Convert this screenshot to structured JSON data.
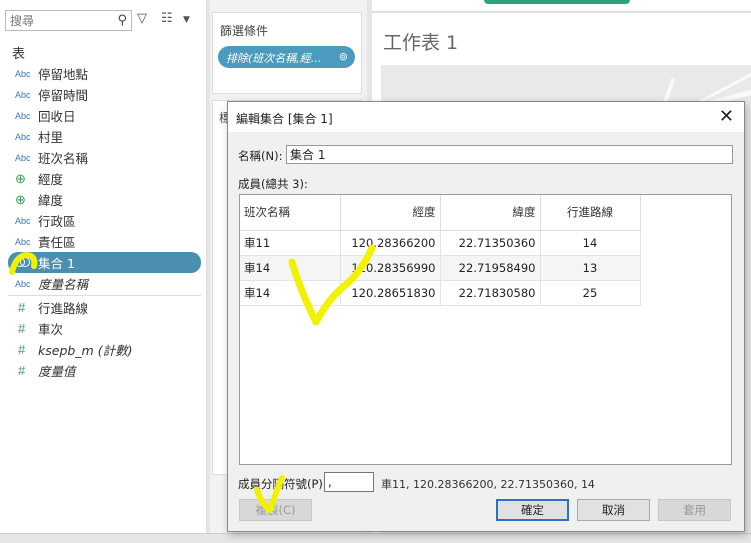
{
  "data_pane": {
    "search_placeholder": "搜尋",
    "section_title": "表",
    "fields": [
      {
        "type": "Abc",
        "label": "停留地點"
      },
      {
        "type": "Abc",
        "label": "停留時間"
      },
      {
        "type": "Abc",
        "label": "回收日"
      },
      {
        "type": "Abc",
        "label": "村里"
      },
      {
        "type": "Abc",
        "label": "班次名稱"
      },
      {
        "type": "globe",
        "label": "經度"
      },
      {
        "type": "globe",
        "label": "緯度"
      },
      {
        "type": "Abc",
        "label": "行政區"
      },
      {
        "type": "Abc",
        "label": "責任區"
      },
      {
        "type": "set",
        "label": "集合 1"
      },
      {
        "type": "Abc",
        "label": "度量名稱"
      },
      {
        "type": "#",
        "label": "行進路線"
      },
      {
        "type": "#",
        "label": "車次"
      },
      {
        "type": "#",
        "label": "ksepb_m (計數)"
      },
      {
        "type": "#",
        "label": "度量值"
      }
    ]
  },
  "filters": {
    "title": "篩選條件",
    "pill": "排除(班次名稱,經..."
  },
  "marks": {
    "title": "標"
  },
  "sheet": {
    "title": "工作表 1"
  },
  "dialog": {
    "title": "編輯集合 [集合 1]",
    "close_glyph": "✕",
    "name_label": "名稱(N):",
    "name_value": "集合 1",
    "members_label": "成員(總共 3):",
    "columns": [
      "班次名稱",
      "經度",
      "緯度",
      "行進路線"
    ],
    "rows": [
      [
        "車11",
        "120.28366200",
        "22.71350360",
        "14"
      ],
      [
        "車14",
        "120.28356990",
        "22.71958490",
        "13"
      ],
      [
        "車14",
        "120.28651830",
        "22.71830580",
        "25"
      ]
    ],
    "separator_label": "成員分隔符號(P)",
    "separator_value": ",",
    "preview": "車11, 120.28366200, 22.71350360, 14",
    "copy_button": "複製(C)",
    "ok_button": "確定",
    "cancel_button": "取消",
    "apply_button": "套用"
  },
  "colors": {
    "selected_field": "#4a8fb0",
    "filter_pill": "#4a9bbd",
    "annotation": "#f2f200"
  }
}
